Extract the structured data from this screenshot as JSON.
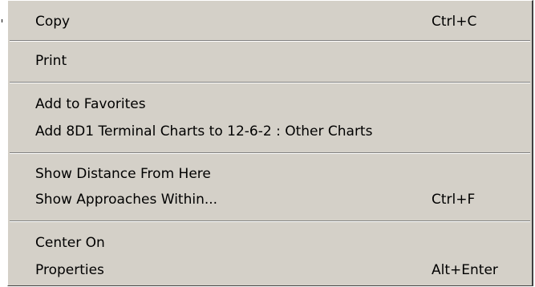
{
  "context_menu": {
    "items": [
      {
        "label": "Copy",
        "shortcut": "Ctrl+C"
      },
      {
        "label": "Print",
        "shortcut": ""
      },
      {
        "label": "Add to Favorites",
        "shortcut": ""
      },
      {
        "label": "Add 8D1 Terminal Charts to 12-6-2 : Other Charts",
        "shortcut": ""
      },
      {
        "label": "Show Distance From Here",
        "shortcut": ""
      },
      {
        "label": "Show Approaches Within...",
        "shortcut": "Ctrl+F"
      },
      {
        "label": "Center On",
        "shortcut": ""
      },
      {
        "label": "Properties",
        "shortcut": "Alt+Enter"
      }
    ]
  }
}
